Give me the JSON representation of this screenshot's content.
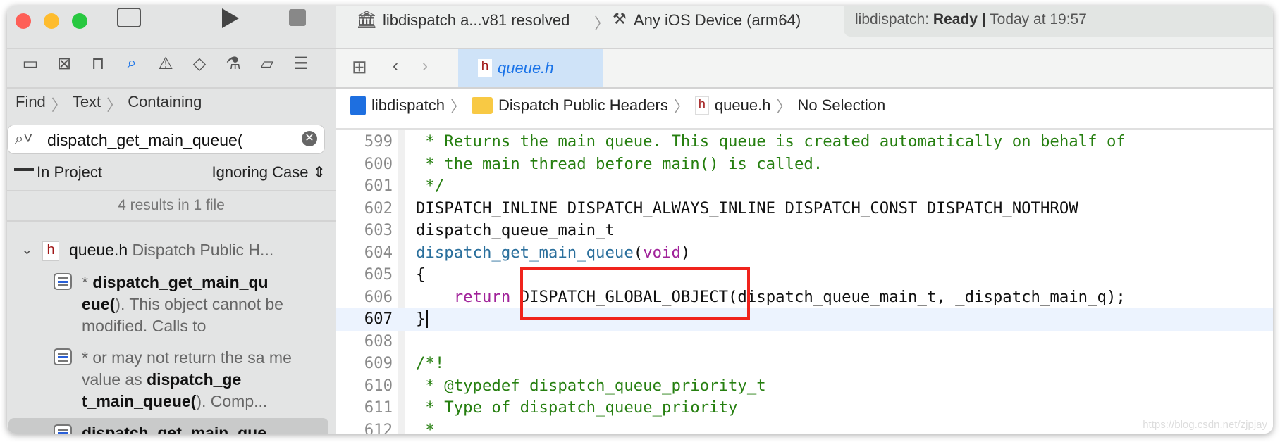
{
  "toolbar": {
    "scheme": "libdispatch a...v81 resolved",
    "destination": "Any iOS Device (arm64)",
    "status_project": "libdispatch:",
    "status_state": "Ready",
    "status_sep": "|",
    "status_time": "Today at 19:57"
  },
  "find": {
    "path": [
      "Find",
      "Text",
      "Containing"
    ],
    "query": "dispatch_get_main_queue(",
    "scope": "In Project",
    "case": "Ignoring Case",
    "summary": "4 results in 1 file"
  },
  "results": {
    "file": "queue.h",
    "group": "Dispatch Public H...",
    "items": [
      {
        "pre": "* ",
        "match": "dispatch_get_main_qu eue(",
        "post": "). This object cannot be modified.  Calls to"
      },
      {
        "pre": "* or may not return the sa me value as ",
        "match": "dispatch_ge t_main_queue(",
        "post": "). Comp..."
      },
      {
        "pre": "",
        "match": "dispatch_get_main_que",
        "post": ""
      }
    ]
  },
  "tab": {
    "label": "queue.h"
  },
  "breadcrumb": [
    "libdispatch",
    "Dispatch Public Headers",
    "queue.h",
    "No Selection"
  ],
  "code": {
    "current_line": "607",
    "lines": [
      {
        "n": "599",
        "parts": [
          [
            "cm",
            " * Returns the main queue. This queue is created automatically on behalf of"
          ]
        ]
      },
      {
        "n": "600",
        "parts": [
          [
            "cm",
            " * the main thread before main() is called."
          ]
        ]
      },
      {
        "n": "601",
        "parts": [
          [
            "cm",
            " */"
          ]
        ]
      },
      {
        "n": "602",
        "parts": [
          [
            "pl",
            "DISPATCH_INLINE DISPATCH_ALWAYS_INLINE DISPATCH_CONST DISPATCH_NOTHROW"
          ]
        ]
      },
      {
        "n": "603",
        "parts": [
          [
            "pl",
            "dispatch_queue_main_t"
          ]
        ]
      },
      {
        "n": "604",
        "parts": [
          [
            "fn",
            "dispatch_get_main_queue"
          ],
          [
            "pl",
            "("
          ],
          [
            "kw",
            "void"
          ],
          [
            "pl",
            ")"
          ]
        ]
      },
      {
        "n": "605",
        "parts": [
          [
            "pl",
            "{"
          ]
        ]
      },
      {
        "n": "606",
        "parts": [
          [
            "pl",
            "    "
          ],
          [
            "kw",
            "return"
          ],
          [
            "pl",
            " DISPATCH_GLOBAL_OBJECT(dispatch_queue_main_t, _dispatch_main_q);"
          ]
        ]
      },
      {
        "n": "607",
        "parts": [
          [
            "pl",
            "}"
          ]
        ]
      },
      {
        "n": "608",
        "parts": []
      },
      {
        "n": "609",
        "parts": [
          [
            "cm",
            "/*!"
          ]
        ]
      },
      {
        "n": "610",
        "parts": [
          [
            "cm",
            " * @typedef dispatch_queue_priority_t"
          ]
        ]
      },
      {
        "n": "611",
        "parts": [
          [
            "cm",
            " * Type of dispatch_queue_priority"
          ]
        ]
      },
      {
        "n": "612",
        "parts": [
          [
            "cm",
            " *"
          ]
        ]
      }
    ]
  },
  "watermark": "https://blog.csdn.net/zjpjay",
  "colors": {
    "highlight_box": "#f0231c",
    "current_line": "#ecf3fe",
    "accent": "#1a73e8"
  }
}
